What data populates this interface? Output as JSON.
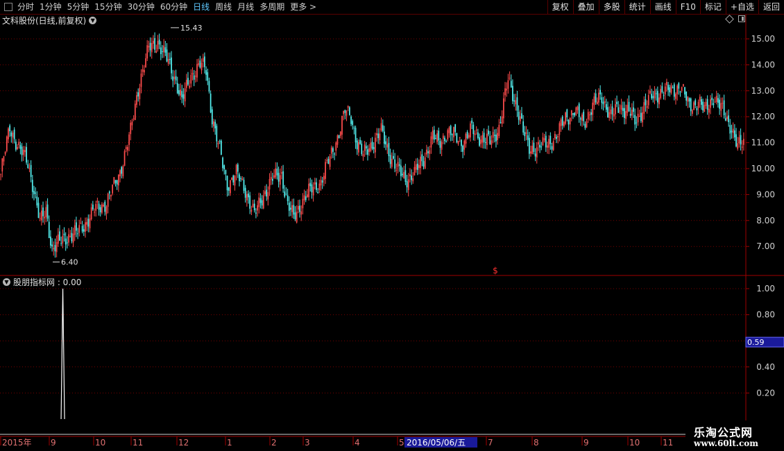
{
  "toolbar": {
    "items": [
      "分时",
      "1分钟",
      "5分钟",
      "15分钟",
      "30分钟",
      "60分钟",
      "日线",
      "周线",
      "月线",
      "多周期",
      "更多 >"
    ],
    "active_index": 6,
    "right_buttons": [
      "复权",
      "叠加",
      "多股",
      "统计",
      "画线",
      "F10",
      "标记",
      "+自选",
      "返回"
    ]
  },
  "main_chart": {
    "title": "文科股份(日线,前复权)",
    "y_ticks": [
      "15.00",
      "14.00",
      "13.00",
      "12.00",
      "11.00",
      "10.00",
      "9.00",
      "8.00",
      "7.00"
    ],
    "max_label": "15.43",
    "min_label": "6.40",
    "dollar_marker": "$"
  },
  "indicator": {
    "title": "股朋指标网 : 0.00",
    "y_ticks": [
      "1.00",
      "0.80",
      "0.40",
      "0.20"
    ],
    "current_value": "0.59"
  },
  "x_axis": {
    "labels": [
      "2015年",
      "9",
      "10",
      "11",
      "12",
      "1",
      "2",
      "3",
      "4",
      "5",
      "7",
      "8",
      "9",
      "10",
      "11"
    ],
    "cursor_date": "2016/05/06/五"
  },
  "watermark": {
    "line1": "乐淘公式网",
    "line2": "www.60lt.com"
  },
  "colors": {
    "up": "#ff4d4d",
    "down": "#54f0f0",
    "grid": "#7a0000",
    "axis": "#a00000",
    "cursor": "#1a1a9a"
  },
  "chart_data": {
    "type": "candlestick",
    "ylim": [
      6.0,
      16.0
    ],
    "close_anchors": [
      [
        0,
        9.8
      ],
      [
        6,
        11.6
      ],
      [
        12,
        10.8
      ],
      [
        18,
        10.2
      ],
      [
        22,
        9.2
      ],
      [
        26,
        7.9
      ],
      [
        30,
        8.4
      ],
      [
        34,
        6.9
      ],
      [
        38,
        7.1
      ],
      [
        44,
        7.4
      ],
      [
        50,
        7.5
      ],
      [
        56,
        7.9
      ],
      [
        62,
        8.4
      ],
      [
        70,
        8.7
      ],
      [
        78,
        9.7
      ],
      [
        86,
        11.4
      ],
      [
        92,
        13.4
      ],
      [
        98,
        14.6
      ],
      [
        104,
        14.9
      ],
      [
        110,
        14.2
      ],
      [
        116,
        13.4
      ],
      [
        120,
        12.6
      ],
      [
        126,
        13.6
      ],
      [
        132,
        14.0
      ],
      [
        136,
        13.8
      ],
      [
        140,
        12.0
      ],
      [
        146,
        10.4
      ],
      [
        150,
        9.4
      ],
      [
        156,
        9.8
      ],
      [
        162,
        9.2
      ],
      [
        168,
        8.2
      ],
      [
        174,
        9.0
      ],
      [
        180,
        9.6
      ],
      [
        186,
        9.8
      ],
      [
        190,
        8.6
      ],
      [
        194,
        8.1
      ],
      [
        200,
        8.8
      ],
      [
        206,
        9.2
      ],
      [
        212,
        9.5
      ],
      [
        218,
        10.4
      ],
      [
        224,
        11.4
      ],
      [
        228,
        12.2
      ],
      [
        232,
        12.0
      ],
      [
        236,
        11.0
      ],
      [
        240,
        10.5
      ],
      [
        246,
        11.0
      ],
      [
        252,
        11.4
      ],
      [
        256,
        10.8
      ],
      [
        262,
        10.0
      ],
      [
        268,
        9.6
      ],
      [
        274,
        9.8
      ],
      [
        280,
        10.4
      ],
      [
        286,
        11.2
      ],
      [
        290,
        11.0
      ],
      [
        296,
        11.4
      ],
      [
        302,
        11.2
      ],
      [
        306,
        11.0
      ],
      [
        312,
        11.5
      ],
      [
        318,
        11.2
      ],
      [
        324,
        11.0
      ],
      [
        330,
        11.6
      ],
      [
        336,
        13.4
      ],
      [
        342,
        12.4
      ],
      [
        346,
        11.4
      ],
      [
        350,
        10.8
      ],
      [
        356,
        10.8
      ],
      [
        362,
        11.0
      ],
      [
        368,
        11.2
      ],
      [
        374,
        12.0
      ],
      [
        380,
        12.2
      ],
      [
        386,
        11.8
      ],
      [
        392,
        12.4
      ],
      [
        398,
        12.8
      ],
      [
        404,
        12.0
      ],
      [
        410,
        12.4
      ],
      [
        416,
        12.2
      ],
      [
        420,
        11.8
      ],
      [
        426,
        12.4
      ],
      [
        432,
        12.8
      ],
      [
        438,
        13.0
      ],
      [
        444,
        13.0
      ],
      [
        450,
        13.2
      ],
      [
        456,
        12.4
      ],
      [
        462,
        12.6
      ],
      [
        466,
        12.2
      ],
      [
        472,
        12.8
      ],
      [
        478,
        12.2
      ],
      [
        484,
        11.6
      ],
      [
        488,
        10.8
      ],
      [
        492,
        11.0
      ]
    ],
    "indicator_series": [
      {
        "spike_bar": 23,
        "spike_value": 1.0,
        "baseline": 0.0
      }
    ],
    "indicator_ylim": [
      0.0,
      1.1
    ],
    "high": 15.43,
    "low": 6.4
  }
}
